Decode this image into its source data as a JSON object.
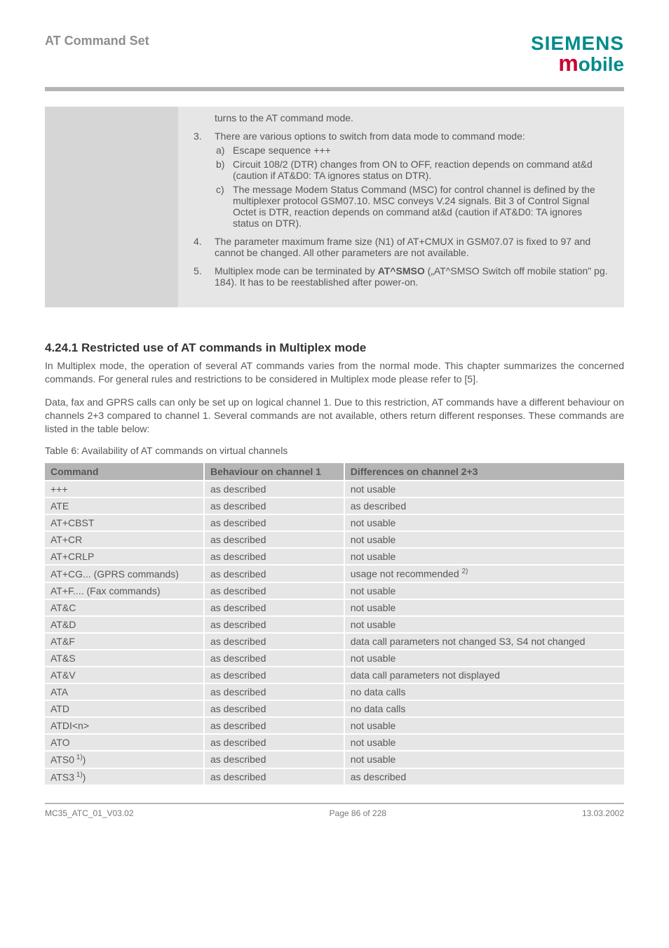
{
  "header": {
    "title": "AT Command Set",
    "brand_line1": "SIEMENS",
    "brand_line2_m": "m",
    "brand_line2_rest": "obile"
  },
  "spec": {
    "pre_line": "turns to the AT command mode.",
    "items": {
      "i3": {
        "num": "3",
        "lead": "There are various options to switch from data mode to command mode:",
        "a": "Escape sequence +++",
        "b": "Circuit 108/2 (DTR) changes from ON to OFF, reaction depends on command at&d (caution if AT&D0: TA ignores status on DTR).",
        "c": "The message Modem Status Command (MSC) for control channel is defined by the multiplexer protocol GSM07.10. MSC conveys V.24 signals. Bit 3 of Control Signal Octet is DTR, reaction depends on command at&d (caution if AT&D0: TA ignores status on DTR)."
      },
      "i4": {
        "num": "4",
        "text": "The parameter maximum frame size (N1) of AT+CMUX in GSM07.07 is fixed to 97 and cannot be changed. All other parameters are not available."
      },
      "i5": {
        "num": "5",
        "pre": "Multiplex mode can be terminated by ",
        "bold": "AT^SMSO",
        "post": " („AT^SMSO  Switch off mobile station\" pg. 184). It has to be reestablished after power-on."
      }
    }
  },
  "section": {
    "title": "4.24.1 Restricted use of AT commands in Multiplex mode",
    "para1": "In Multiplex mode, the operation of several AT commands varies from the normal mode. This chapter summarizes the concerned commands. For general rules and restrictions to be considered in Multiplex mode please refer to [5].",
    "para2": "Data, fax and GPRS calls can only be set up on logical channel 1. Due to this restriction, AT commands have a different behaviour on channels 2+3 compared to channel 1. Several commands are not available, others return different responses. These commands are listed in the table below:"
  },
  "table_caption": "Table 6: Availability of AT commands on virtual channels",
  "table": {
    "headers": [
      "Command",
      "Behaviour on channel 1",
      "Differences on channel 2+3"
    ],
    "rows": [
      {
        "c": "+++",
        "b": "as described",
        "d": "not usable",
        "sup": ""
      },
      {
        "c": "ATE",
        "b": "as described",
        "d": "as described",
        "sup": ""
      },
      {
        "c": "AT+CBST",
        "b": "as described",
        "d": "not usable",
        "sup": ""
      },
      {
        "c": "AT+CR",
        "b": "as described",
        "d": "not usable",
        "sup": ""
      },
      {
        "c": "AT+CRLP",
        "b": "as described",
        "d": "not usable",
        "sup": ""
      },
      {
        "c": "AT+CG... (GPRS commands)",
        "b": "as described",
        "d": "usage not recommended ",
        "sup": "2)"
      },
      {
        "c": "AT+F.... (Fax commands)",
        "b": "as described",
        "d": "not usable",
        "sup": ""
      },
      {
        "c": "AT&C",
        "b": "as described",
        "d": "not usable",
        "sup": ""
      },
      {
        "c": "AT&D",
        "b": "as described",
        "d": "not usable",
        "sup": ""
      },
      {
        "c": "AT&F",
        "b": "as described",
        "d": "data call parameters not changed S3, S4 not changed",
        "sup": ""
      },
      {
        "c": "AT&S",
        "b": "as described",
        "d": "not usable",
        "sup": ""
      },
      {
        "c": "AT&V",
        "b": "as described",
        "d": "data call parameters not displayed",
        "sup": ""
      },
      {
        "c": "ATA",
        "b": "as described",
        "d": "no data calls",
        "sup": ""
      },
      {
        "c": "ATD",
        "b": "as described",
        "d": "no data calls",
        "sup": ""
      },
      {
        "c": "ATDI<n>",
        "b": "as described",
        "d": "not usable",
        "sup": ""
      },
      {
        "c": "ATO",
        "b": "as described",
        "d": "not usable",
        "sup": ""
      },
      {
        "c": "ATS0",
        "b": "as described",
        "d": "not usable",
        "sup": " 1)",
        "csup": true
      },
      {
        "c": "ATS3",
        "b": "as described",
        "d": "as described",
        "sup": " 1)",
        "csup": true
      }
    ]
  },
  "footer": {
    "left": "MC35_ATC_01_V03.02",
    "center": "Page 86 of 228",
    "right": "13.03.2002"
  }
}
